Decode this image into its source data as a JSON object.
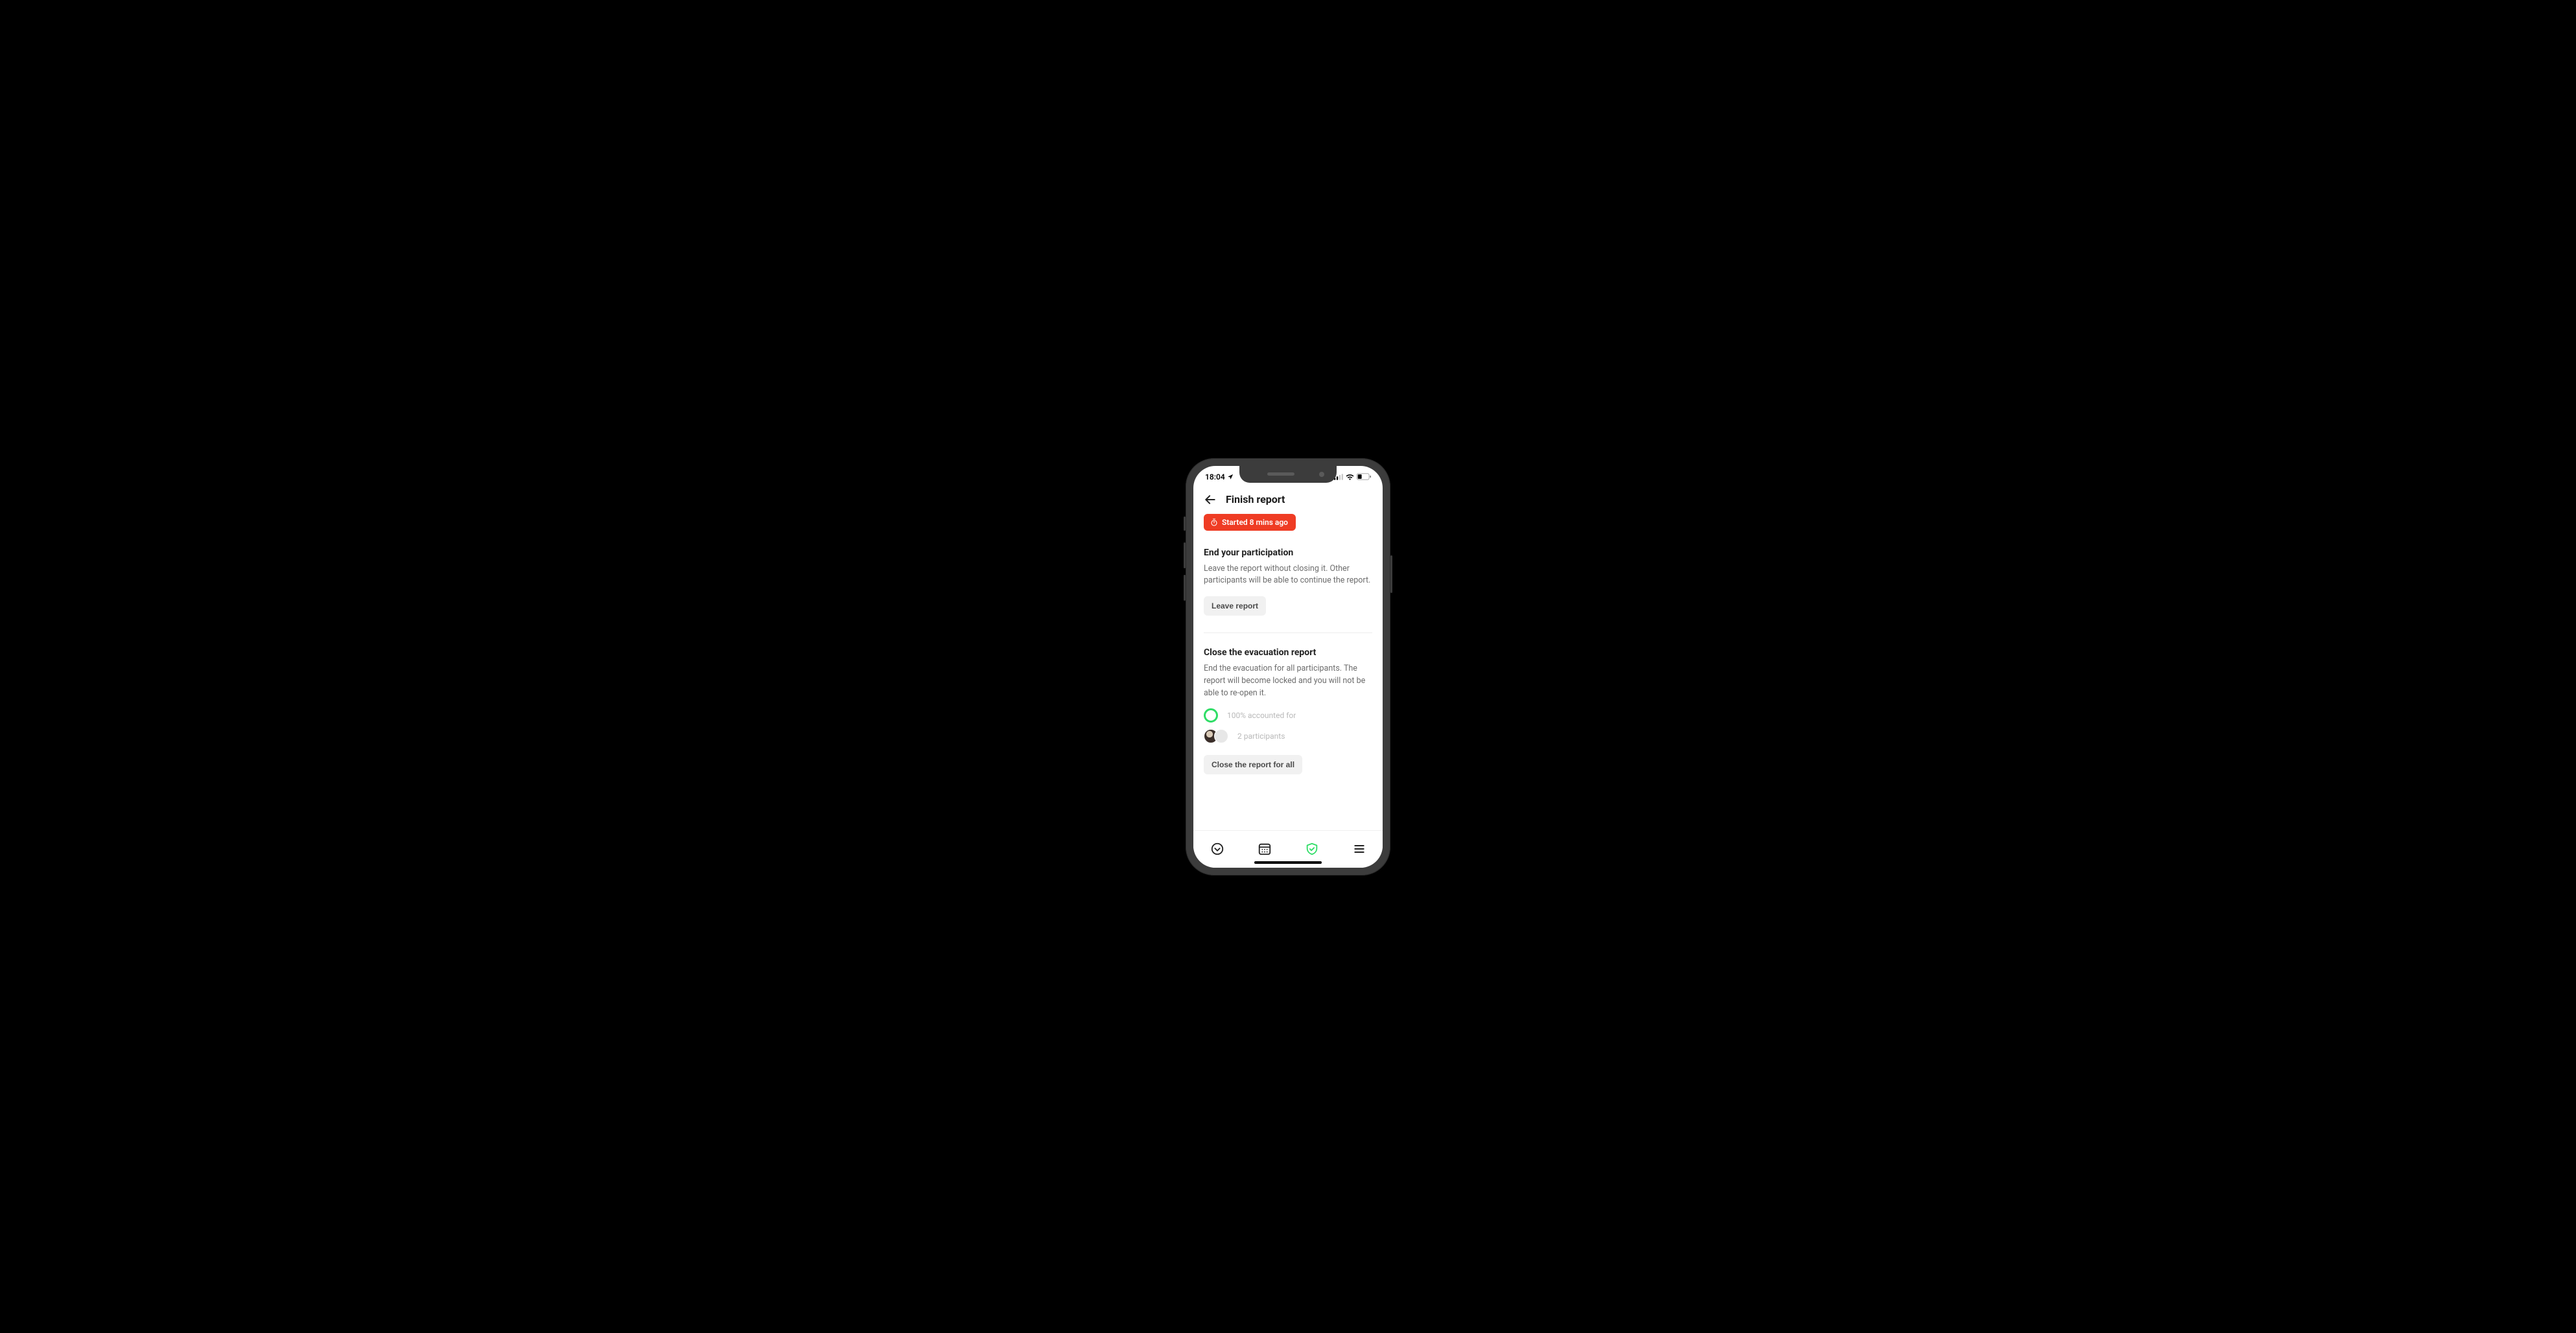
{
  "status": {
    "time": "18:04"
  },
  "header": {
    "title": "Finish report"
  },
  "timer": {
    "label": "Started 8 mins ago"
  },
  "sections": {
    "leave": {
      "title": "End your participation",
      "desc": "Leave the report without closing it. Other participants will be able to continue the report.",
      "button": "Leave report"
    },
    "close": {
      "title": "Close the evacuation report",
      "desc": "End the evacuation for all participants. The report will become locked and you will not be able to re-open it.",
      "accounted": "100% accounted for",
      "participants": "2 participants",
      "button": "Close the report for all"
    }
  }
}
